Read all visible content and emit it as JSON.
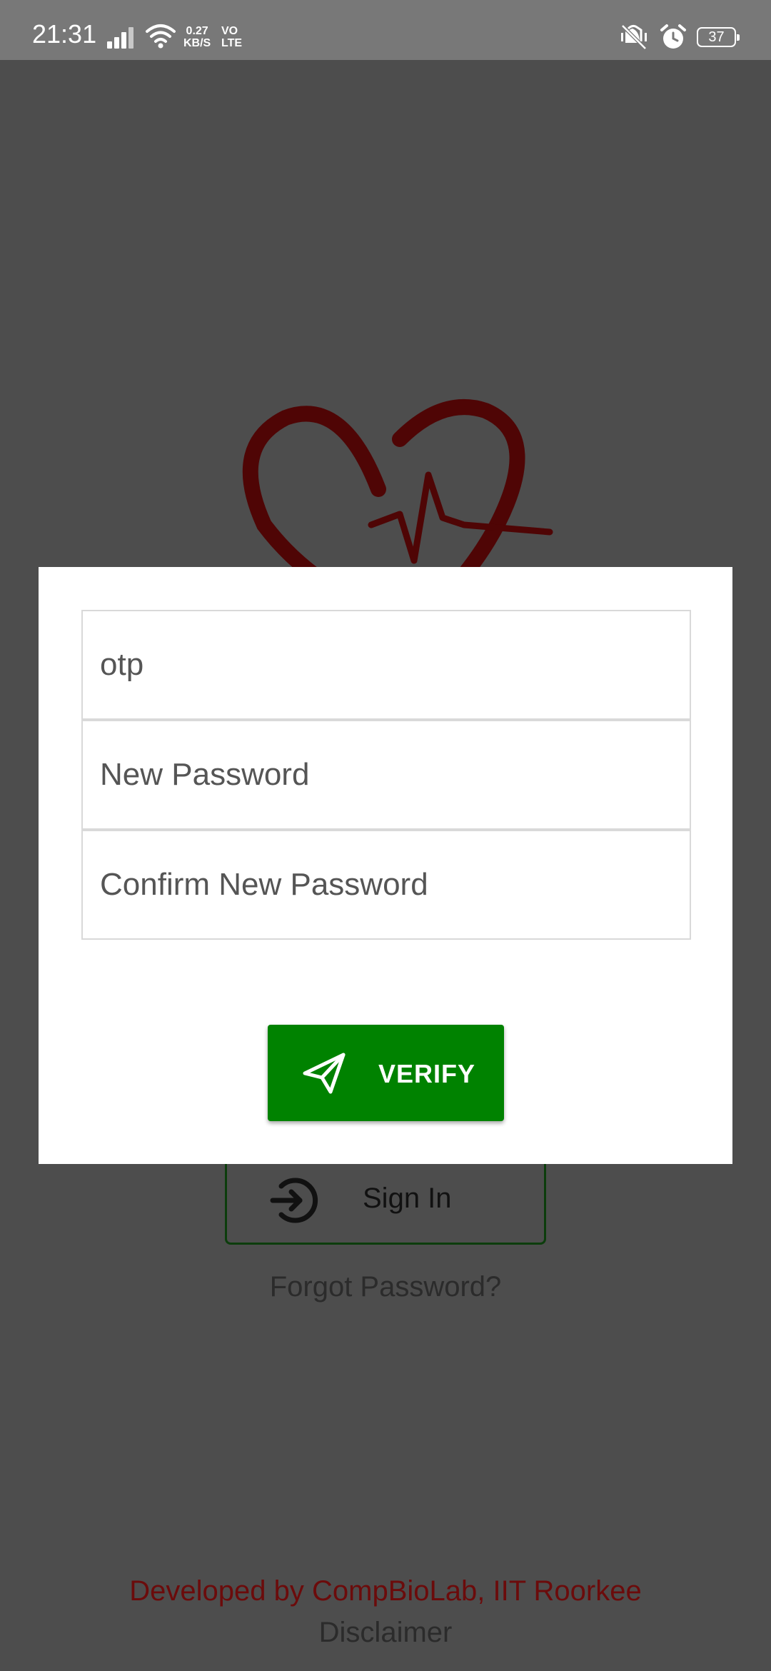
{
  "status_bar": {
    "time": "21:31",
    "net_speed_value": "0.27",
    "net_speed_unit": "KB/S",
    "volte_top": "VO",
    "volte_bottom": "LTE",
    "battery": "37",
    "icons": [
      "signal-icon",
      "wifi-icon",
      "mute-icon",
      "alarm-icon",
      "battery-icon"
    ]
  },
  "dialog": {
    "otp_placeholder": "otp",
    "new_password_placeholder": "New Password",
    "confirm_password_placeholder": "Confirm New Password",
    "verify_label": "VERIFY",
    "verify_icon": "send-icon"
  },
  "background": {
    "logo_icon": "heart-pulse-icon",
    "signin_label": "Sign In",
    "signin_icon": "login-icon",
    "forgot_password": "Forgot Password?",
    "developed_by": "Developed by CompBioLab, IIT Roorkee",
    "disclaimer": "Disclaimer"
  },
  "colors": {
    "scrim": "#4d4d4d",
    "status_bar": "#787878",
    "verify_button": "#008200",
    "logo_dimmed": "#4f0505",
    "footer_text": "#6b0b0b"
  }
}
